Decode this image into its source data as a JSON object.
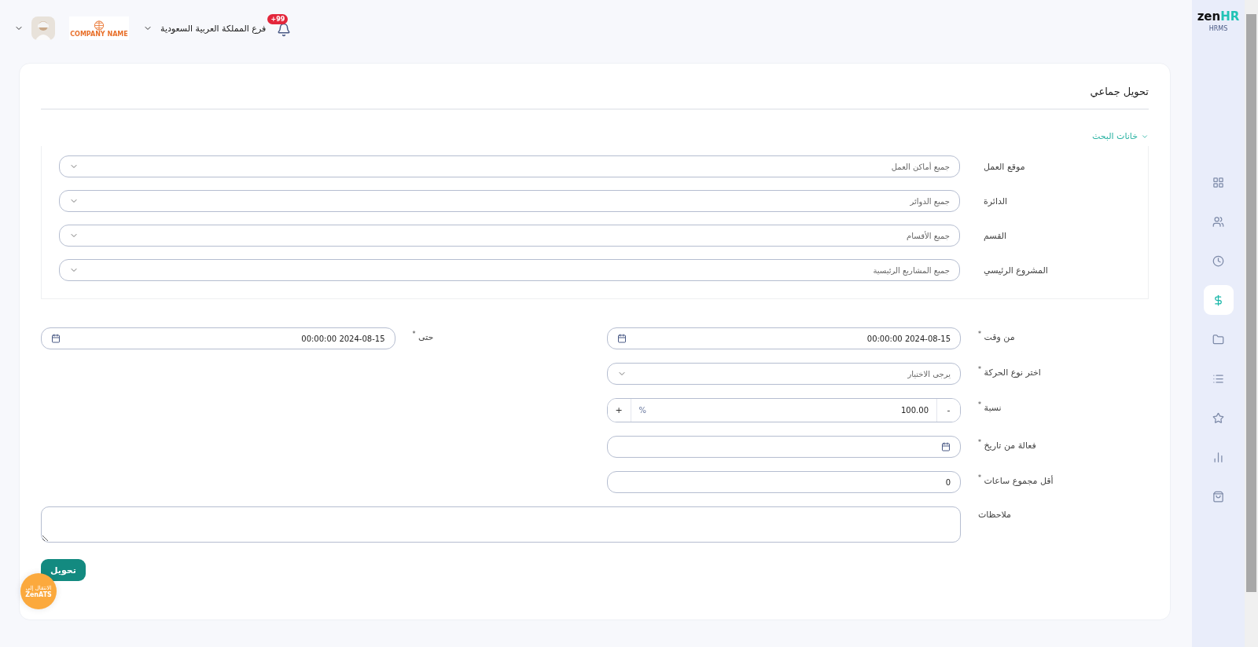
{
  "header": {
    "notification_count": "+99",
    "branch": "فرع المملكة العربية السعودية",
    "company_logo_text": "COMPANY NAME"
  },
  "sidebar": {
    "logo_main": "zen",
    "logo_accent": "HR",
    "subtitle": "HRMS",
    "items": [
      {
        "selected": false
      },
      {
        "selected": false
      },
      {
        "selected": false
      },
      {
        "selected": true
      },
      {
        "selected": false
      },
      {
        "selected": false
      },
      {
        "selected": false
      },
      {
        "selected": false
      },
      {
        "selected": false
      }
    ]
  },
  "page_title": "تحويل جماعي",
  "search_section": {
    "label": "خانات البحث",
    "expanded": true,
    "filters": [
      {
        "label": "موقع العمل",
        "value": "جميع أماكن العمل"
      },
      {
        "label": "الدائرة",
        "value": "جميع الدوائر"
      },
      {
        "label": "القسم",
        "value": "جميع الأقسام"
      },
      {
        "label": "المشروع الرئيسي",
        "value": "جميع المشاريع الرئيسية"
      }
    ]
  },
  "form_rows": [
    [
      {
        "kind": "date",
        "label": "من وقت $^{*}$",
        "value": "2024-08-15 00:00:00"
      },
      {
        "kind": "date",
        "label": "حتى $^{*}$",
        "value": "2024-08-15 00:00:00"
      }
    ],
    [
      {
        "kind": "select",
        "label": "اختر نوع الحركة $^{*}$",
        "placeholder": "يرجى الاختيار"
      }
    ],
    [
      {
        "kind": "stepper",
        "label": "نسبة $^{*}$",
        "value": "100.00",
        "unit": "%",
        "decrement": "-",
        "increment": "+"
      }
    ],
    [
      {
        "kind": "date",
        "label": "فعالة من تاريخ $^{*}$"
      }
    ],
    [
      {
        "kind": "text",
        "label": "أقل مجموع ساعات $^{*}$",
        "value": "0"
      }
    ]
  ],
  "notes": {
    "label": "ملاحظات"
  },
  "submit": "تحويل",
  "ats_badge": {
    "line1": "الانتقال إلى",
    "line2": "ZenATS"
  }
}
